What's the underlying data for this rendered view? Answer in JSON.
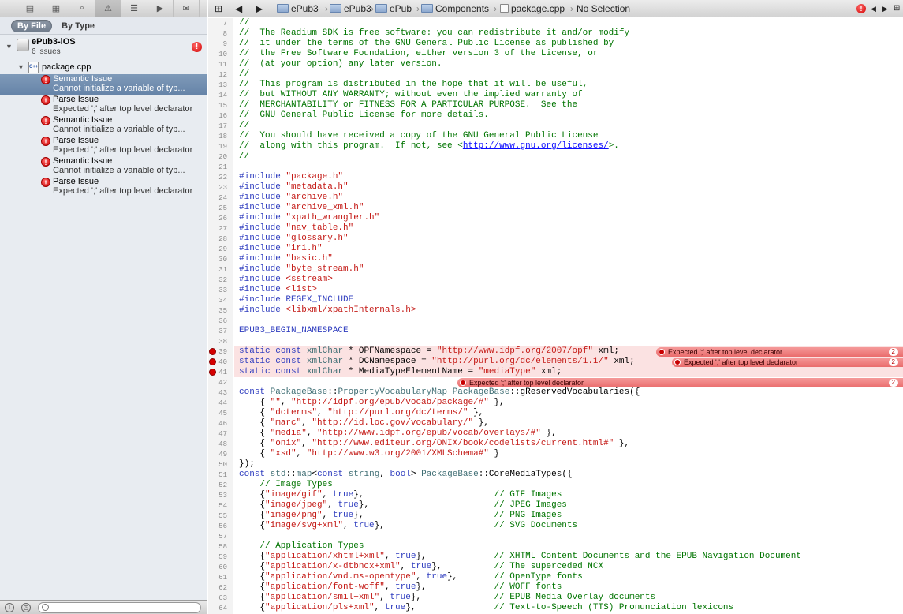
{
  "navigator": {
    "filter_by_file": "By File",
    "filter_by_type": "By Type",
    "project": {
      "name": "ePub3-iOS",
      "issue_count": "6 issues",
      "badge": "!"
    },
    "file": {
      "name": "package.cpp",
      "icon_text": "C++"
    },
    "issues": [
      {
        "title": "Semantic Issue",
        "detail": "Cannot initialize a variable of typ...",
        "selected": true,
        "icon": "!"
      },
      {
        "title": "Parse Issue",
        "detail": "Expected ';' after top level declarator",
        "selected": false,
        "icon": "!"
      },
      {
        "title": "Semantic Issue",
        "detail": "Cannot initialize a variable of typ...",
        "selected": false,
        "icon": "!"
      },
      {
        "title": "Parse Issue",
        "detail": "Expected ';' after top level declarator",
        "selected": false,
        "icon": "!"
      },
      {
        "title": "Semantic Issue",
        "detail": "Cannot initialize a variable of typ...",
        "selected": false,
        "icon": "!"
      },
      {
        "title": "Parse Issue",
        "detail": "Expected ';' after top level declarator",
        "selected": false,
        "icon": "!"
      }
    ]
  },
  "jumpbar": {
    "crumbs": [
      "ePub3",
      "ePub3",
      "ePub",
      "Components",
      "package.cpp",
      "No Selection"
    ]
  },
  "editor": {
    "line_numbers": [
      "7",
      "8",
      "9",
      "10",
      "11",
      "12",
      "13",
      "14",
      "15",
      "16",
      "17",
      "18",
      "19",
      "20",
      "21",
      "22",
      "23",
      "24",
      "25",
      "26",
      "27",
      "28",
      "29",
      "30",
      "31",
      "32",
      "33",
      "34",
      "35",
      "36",
      "37",
      "38",
      "39",
      "40",
      "41",
      "42",
      "43",
      "44",
      "45",
      "46",
      "47",
      "48",
      "49",
      "50",
      "51",
      "52",
      "53",
      "54",
      "55",
      "56",
      "57",
      "58",
      "59",
      "60",
      "61",
      "62",
      "63",
      "64"
    ],
    "errors": [
      {
        "line": "39",
        "message": "Expected ';' after top level declarator",
        "count": "2"
      },
      {
        "line": "40",
        "message": "Expected ';' after top level declarator",
        "count": "2"
      },
      {
        "line": "41",
        "message": "Expected ';' after top level declarator",
        "count": "2"
      }
    ]
  }
}
